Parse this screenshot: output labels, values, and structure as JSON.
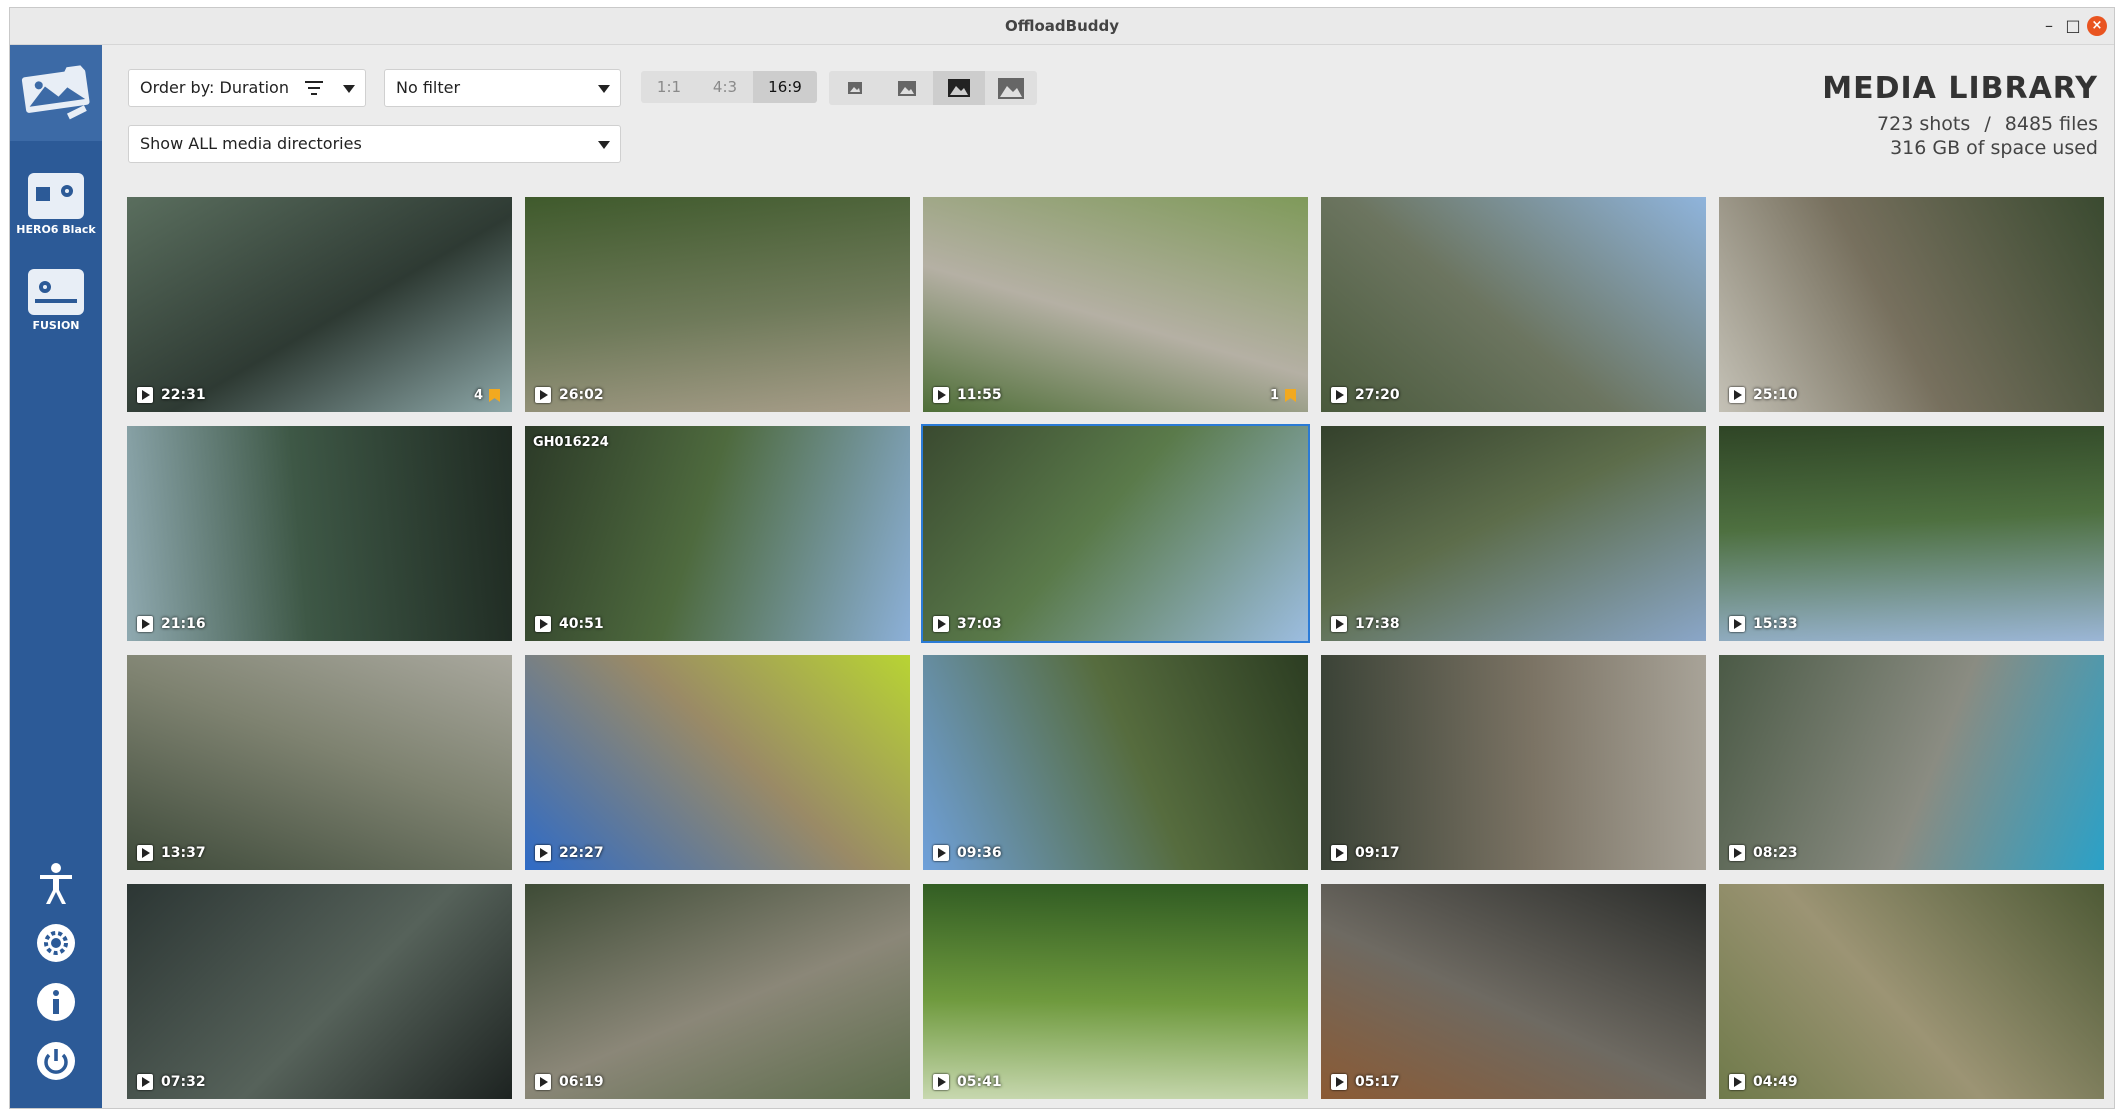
{
  "window": {
    "title": "OffloadBuddy",
    "minimize": "–",
    "maximize": "□",
    "close": "×"
  },
  "sidebar": {
    "devices": [
      {
        "label": "HERO6 Black",
        "icon": "gopro-camera-icon"
      },
      {
        "label": "FUSION",
        "icon": "fusion-camera-icon"
      }
    ],
    "bottom_icons": [
      "accessibility-icon",
      "settings-gear-icon",
      "info-icon",
      "power-icon"
    ]
  },
  "toolbar": {
    "order_by": "Order by: Duration",
    "filter": "No filter",
    "directories": "Show ALL media directories",
    "aspect_ratios": [
      "1:1",
      "4:3",
      "16:9"
    ],
    "aspect_selected": "16:9",
    "thumb_sizes": [
      "thumb-size-small-icon",
      "thumb-size-medium-icon",
      "thumb-size-large-icon",
      "thumb-size-xlarge-icon"
    ],
    "thumb_size_selected": 2
  },
  "library": {
    "title": "MEDIA LIBRARY",
    "shots": "723 shots",
    "separator": "/",
    "files": "8485 files",
    "space": "316 GB of space used"
  },
  "media": [
    {
      "duration": "22:31",
      "highlights": "4",
      "colors": [
        "#5a6e5e",
        "#2e3a33",
        "#8da7a8"
      ]
    },
    {
      "duration": "26:02",
      "colors": [
        "#3f5a2c",
        "#6f7a5a",
        "#a89e8a"
      ]
    },
    {
      "duration": "11:55",
      "highlights": "1",
      "colors": [
        "#7f9a5a",
        "#b5b0a4",
        "#4e6e37"
      ]
    },
    {
      "duration": "27:20",
      "colors": [
        "#8fb4dc",
        "#6c7560",
        "#4a5a3c"
      ]
    },
    {
      "duration": "25:10",
      "colors": [
        "#3a4a30",
        "#77705e",
        "#c4c1b6"
      ]
    },
    {
      "duration": "21:16",
      "colors": [
        "#1f2a22",
        "#3e5846",
        "#8fa9b0"
      ]
    },
    {
      "duration": "40:51",
      "filename": "GH016224",
      "colors": [
        "#8cb0d8",
        "#4e6a3e",
        "#2c3a28"
      ]
    },
    {
      "duration": "37:03",
      "selected": true,
      "colors": [
        "#9cbde0",
        "#5a7a4a",
        "#3a4a30"
      ]
    },
    {
      "duration": "17:38",
      "colors": [
        "#8aa6c8",
        "#5d6d4b",
        "#34412c"
      ]
    },
    {
      "duration": "15:33",
      "colors": [
        "#9bb6d6",
        "#4e7040",
        "#2f4526"
      ]
    },
    {
      "duration": "13:37",
      "colors": [
        "#3e4a3a",
        "#7e8270",
        "#a9a89e"
      ]
    },
    {
      "duration": "22:27",
      "colors": [
        "#2f6bc6",
        "#9a8a66",
        "#b8d433"
      ]
    },
    {
      "duration": "09:36",
      "colors": [
        "#6fa0da",
        "#566c3e",
        "#2c3d22"
      ]
    },
    {
      "duration": "09:17",
      "colors": [
        "#3a4236",
        "#7b7364",
        "#a8a398"
      ]
    },
    {
      "duration": "08:23",
      "colors": [
        "#4b5a46",
        "#8a8c82",
        "#2aa1c8"
      ]
    },
    {
      "duration": "07:32",
      "colors": [
        "#2c3634",
        "#56625a",
        "#1d2321"
      ]
    },
    {
      "duration": "06:19",
      "colors": [
        "#3e4b36",
        "#8b8778",
        "#5d6d4c"
      ]
    },
    {
      "duration": "05:41",
      "colors": [
        "#2f5a22",
        "#6f9a3e",
        "#c8d8b0"
      ]
    },
    {
      "duration": "05:17",
      "colors": [
        "#2a2c2a",
        "#6e6a62",
        "#8b5a34"
      ]
    },
    {
      "duration": "04:49",
      "colors": [
        "#4e5a36",
        "#9c9474",
        "#6f7a4a"
      ]
    }
  ]
}
